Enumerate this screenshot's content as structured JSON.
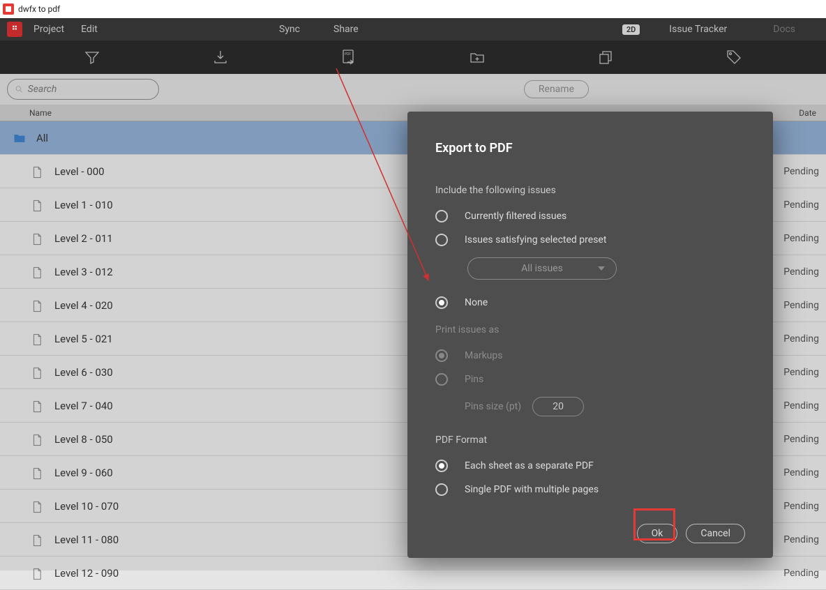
{
  "window": {
    "title": "dwfx to pdf"
  },
  "menu": {
    "project": "Project",
    "edit": "Edit",
    "sync": "Sync",
    "share": "Share",
    "badge_2d": "2D",
    "issue_tracker": "Issue Tracker",
    "docs": "Docs"
  },
  "search": {
    "placeholder": "Search"
  },
  "buttons": {
    "rename": "Rename"
  },
  "columns": {
    "name": "Name",
    "date": "Date"
  },
  "root_folder": "All",
  "files": [
    {
      "name": "Level - 000",
      "status": "Pending"
    },
    {
      "name": "Level 1 - 010",
      "status": "Pending"
    },
    {
      "name": "Level 2 - 011",
      "status": "Pending"
    },
    {
      "name": "Level 3 - 012",
      "status": "Pending"
    },
    {
      "name": "Level 4 - 020",
      "status": "Pending"
    },
    {
      "name": "Level 5 - 021",
      "status": "Pending"
    },
    {
      "name": "Level 6 - 030",
      "status": "Pending"
    },
    {
      "name": "Level 7 - 040",
      "status": "Pending"
    },
    {
      "name": "Level 8 - 050",
      "status": "Pending"
    },
    {
      "name": "Level 9 - 060",
      "status": "Pending"
    },
    {
      "name": "Level 10 - 070",
      "status": "Pending"
    },
    {
      "name": "Level 11 - 080",
      "status": "Pending"
    },
    {
      "name": "Level 12 - 090",
      "status": "Pending"
    }
  ],
  "modal": {
    "title": "Export to PDF",
    "include_label": "Include the following issues",
    "opt_filtered": "Currently filtered issues",
    "opt_preset": "Issues satisfying selected preset",
    "preset_value": "All issues",
    "opt_none": "None",
    "print_label": "Print issues as",
    "opt_markups": "Markups",
    "opt_pins": "Pins",
    "pins_size_label": "Pins size (pt)",
    "pins_size_value": "20",
    "format_label": "PDF Format",
    "opt_separate": "Each sheet as a separate PDF",
    "opt_single": "Single PDF with multiple pages",
    "ok": "Ok",
    "cancel": "Cancel"
  }
}
